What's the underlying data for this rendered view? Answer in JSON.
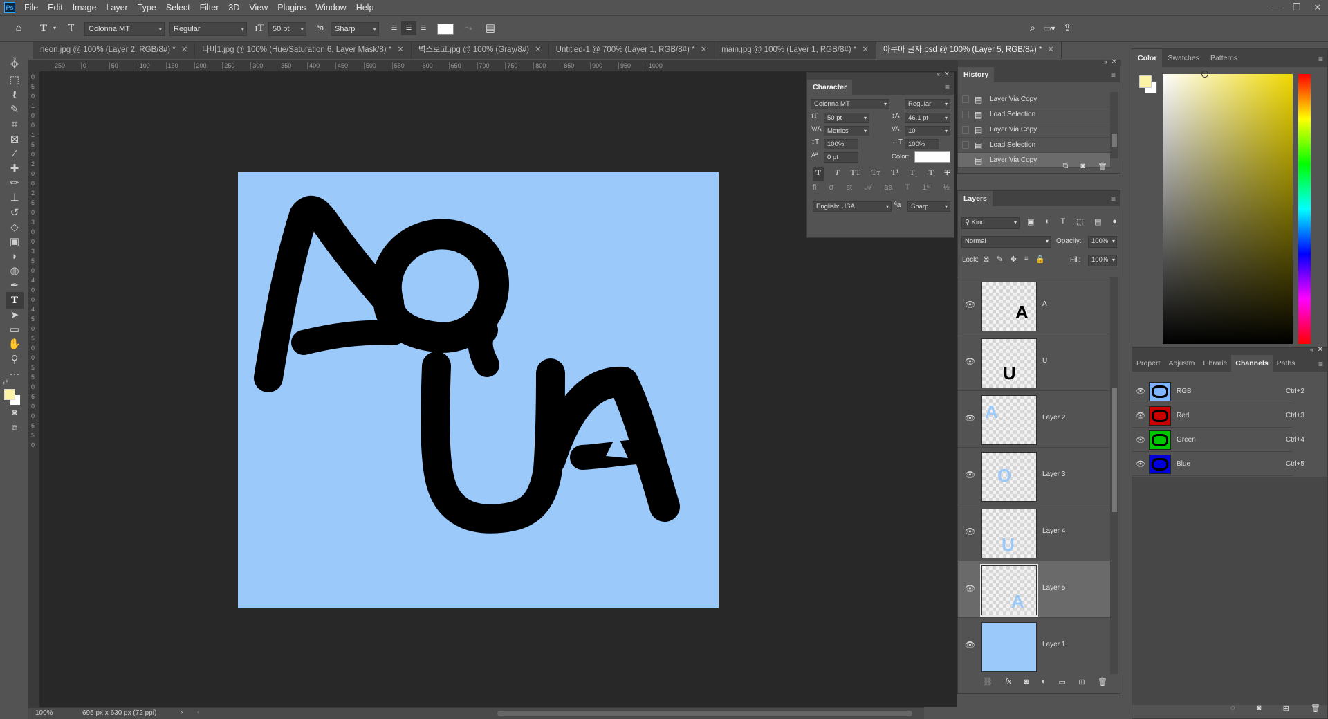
{
  "menu": [
    "File",
    "Edit",
    "Image",
    "Layer",
    "Type",
    "Select",
    "Filter",
    "3D",
    "View",
    "Plugins",
    "Window",
    "Help"
  ],
  "window_controls": {
    "minimize": "—",
    "restore": "❐",
    "close": "✕"
  },
  "options": {
    "font_family": "Colonna MT",
    "font_style": "Regular",
    "font_size": "50 pt",
    "anti_alias": "Sharp",
    "text_color": "#ffffff"
  },
  "tabs": [
    {
      "label": "neon.jpg @ 100% (Layer 2, RGB/8#) *"
    },
    {
      "label": "나비1.jpg @ 100% (Hue/Saturation 6, Layer Mask/8) *"
    },
    {
      "label": "벽스로고.jpg @ 100% (Gray/8#)"
    },
    {
      "label": "Untitled-1 @ 700% (Layer 1, RGB/8#) *"
    },
    {
      "label": "main.jpg @ 100% (Layer 1, RGB/8#) *"
    },
    {
      "label": "아쿠아 글자.psd @ 100% (Layer 5, RGB/8#) *"
    }
  ],
  "ruler_top": [
    "250",
    "0",
    "50",
    "100",
    "150",
    "200",
    "250",
    "300",
    "350",
    "400",
    "450",
    "500",
    "550",
    "600",
    "650",
    "700",
    "750",
    "800",
    "850",
    "900",
    "950",
    "1000"
  ],
  "ruler_left": [
    "0",
    "5",
    "0",
    "1",
    "0",
    "0",
    "1",
    "5",
    "0",
    "2",
    "0",
    "0",
    "2",
    "5",
    "0",
    "3",
    "0",
    "0",
    "3",
    "5",
    "0",
    "4",
    "0",
    "0",
    "4",
    "5",
    "0",
    "5",
    "0",
    "0",
    "5",
    "5",
    "0",
    "6",
    "0",
    "0",
    "6",
    "5",
    "0"
  ],
  "canvas": {
    "bg": "#9bc9fa",
    "artwork": "AQUA"
  },
  "status": {
    "zoom": "100%",
    "doc_size": "695 px x 630 px (72 ppi)"
  },
  "character": {
    "title": "Character",
    "font": "Colonna MT",
    "style": "Regular",
    "size": "50 pt",
    "leading": "46.1 pt",
    "kerning": "Metrics",
    "tracking": "10",
    "vscale": "100%",
    "hscale": "100%",
    "baseline": "0 pt",
    "color_label": "Color:",
    "language": "English: USA",
    "aa": "Sharp"
  },
  "history": {
    "title": "History",
    "items": [
      "Layer Via Copy",
      "Load Selection",
      "Layer Via Copy",
      "Load Selection",
      "Layer Via Copy"
    ]
  },
  "layers": {
    "title": "Layers",
    "kind": "Kind",
    "blend": "Normal",
    "opacity_label": "Opacity:",
    "opacity": "100%",
    "lock_label": "Lock:",
    "fill_label": "Fill:",
    "fill": "100%",
    "items": [
      {
        "name": "A",
        "glyph": "A",
        "glyph_color": "#000000"
      },
      {
        "name": "U",
        "glyph": "U",
        "glyph_color": "#000000"
      },
      {
        "name": "Layer 2",
        "glyph": "A",
        "glyph_color": "#9bc9fa"
      },
      {
        "name": "Layer 3",
        "glyph": "O",
        "glyph_color": "#9bc9fa"
      },
      {
        "name": "Layer 4",
        "glyph": "U",
        "glyph_color": "#9bc9fa"
      },
      {
        "name": "Layer 5",
        "glyph": "A",
        "glyph_color": "#9bc9fa"
      },
      {
        "name": "Layer 1",
        "glyph": "",
        "glyph_color": "#9bc9fa"
      }
    ]
  },
  "color_panel": {
    "tabs": [
      "Color",
      "Swatches",
      "Patterns"
    ],
    "foreground": "#fdf3a7",
    "hue": "#f0d800"
  },
  "bottom_panel": {
    "tabs": [
      "Propert",
      "Adjustm",
      "Librarie",
      "Channels",
      "Paths"
    ],
    "channels": [
      {
        "name": "RGB",
        "shortcut": "Ctrl+2",
        "tint": "#7fb4ff"
      },
      {
        "name": "Red",
        "shortcut": "Ctrl+3",
        "tint": "#c80000"
      },
      {
        "name": "Green",
        "shortcut": "Ctrl+4",
        "tint": "#00c800"
      },
      {
        "name": "Blue",
        "shortcut": "Ctrl+5",
        "tint": "#0000d8"
      }
    ]
  }
}
